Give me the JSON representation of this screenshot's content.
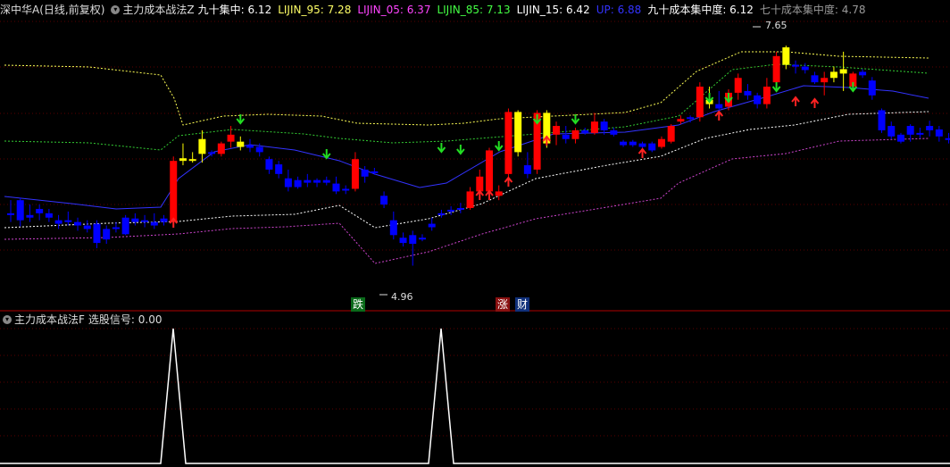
{
  "main_panel": {
    "stock_title": "深中华A(日线,前复权)",
    "indicator_name": "主力成本战法Z",
    "values": [
      {
        "label": "九十集中: 6.12",
        "color": "#ffffff"
      },
      {
        "label": "LIJIN_95: 7.28",
        "color": "#ffff66"
      },
      {
        "label": "LIJIN_05: 6.37",
        "color": "#ff44ff"
      },
      {
        "label": "LIJIN_85: 7.13",
        "color": "#44ff44"
      },
      {
        "label": "LIJIN_15: 6.42",
        "color": "#ffffff"
      },
      {
        "label": "UP: 6.88",
        "color": "#3333ff"
      },
      {
        "label": "九十成本集中度: 6.12",
        "color": "#ffffff"
      },
      {
        "label": "七十成本集中度: 4.78",
        "color": "#999999"
      }
    ],
    "high_label": "7.65",
    "low_label": "4.96",
    "signals": [
      {
        "text": "跌",
        "bg": "#0a6a1a",
        "color": "#ffffff"
      },
      {
        "text": "涨",
        "bg": "#8a1010",
        "color": "#ffffff"
      },
      {
        "text": "财",
        "bg": "#10307a",
        "color": "#ffffff"
      }
    ]
  },
  "sub_panel": {
    "indicator_name": "主力成本战法F",
    "value_label": "选股信号: 0.00"
  },
  "colors": {
    "background": "#000000",
    "up_candle": "#ff0000",
    "down_candle": "#0000ff",
    "yellow_candle": "#ffff00",
    "divider": "#b00000"
  },
  "candles": [
    [
      5.8,
      5.95,
      5.7,
      5.8,
      "b"
    ],
    [
      5.95,
      5.98,
      5.65,
      5.72,
      "b"
    ],
    [
      5.75,
      5.9,
      5.7,
      5.78,
      "b"
    ],
    [
      5.85,
      5.9,
      5.72,
      5.8,
      "b"
    ],
    [
      5.8,
      5.85,
      5.7,
      5.75,
      "b"
    ],
    [
      5.72,
      5.78,
      5.62,
      5.68,
      "b"
    ],
    [
      5.7,
      5.82,
      5.66,
      5.72,
      "b"
    ],
    [
      5.7,
      5.75,
      5.6,
      5.66,
      "b"
    ],
    [
      5.66,
      5.72,
      5.58,
      5.62,
      "b"
    ],
    [
      5.68,
      5.72,
      5.4,
      5.46,
      "b"
    ],
    [
      5.62,
      5.66,
      5.45,
      5.5,
      "b"
    ],
    [
      5.62,
      5.7,
      5.58,
      5.64,
      "b"
    ],
    [
      5.75,
      5.78,
      5.55,
      5.56,
      "b"
    ],
    [
      5.74,
      5.8,
      5.66,
      5.7,
      "b"
    ],
    [
      5.7,
      5.78,
      5.64,
      5.72,
      "b"
    ],
    [
      5.7,
      5.8,
      5.62,
      5.66,
      "b"
    ],
    [
      5.74,
      5.78,
      5.66,
      5.7,
      "b"
    ],
    [
      5.7,
      6.45,
      5.68,
      6.4,
      "r"
    ],
    [
      6.4,
      6.6,
      6.35,
      6.43,
      "y"
    ],
    [
      6.4,
      6.5,
      6.38,
      6.42,
      "y"
    ],
    [
      6.65,
      6.75,
      6.38,
      6.48,
      "y"
    ],
    [
      6.48,
      6.52,
      6.45,
      6.5,
      "b"
    ],
    [
      6.48,
      6.62,
      6.45,
      6.6,
      "r"
    ],
    [
      6.62,
      6.8,
      6.55,
      6.7,
      "r"
    ],
    [
      6.62,
      6.68,
      6.52,
      6.56,
      "y"
    ],
    [
      6.58,
      6.65,
      6.5,
      6.55,
      "b"
    ],
    [
      6.56,
      6.6,
      6.45,
      6.5,
      "b"
    ],
    [
      6.42,
      6.45,
      6.25,
      6.3,
      "b"
    ],
    [
      6.36,
      6.4,
      6.2,
      6.25,
      "b"
    ],
    [
      6.2,
      6.3,
      6.05,
      6.1,
      "b"
    ],
    [
      6.18,
      6.22,
      6.08,
      6.1,
      "b"
    ],
    [
      6.18,
      6.25,
      6.1,
      6.15,
      "b"
    ],
    [
      6.18,
      6.2,
      6.1,
      6.15,
      "b"
    ],
    [
      6.18,
      6.22,
      6.12,
      6.15,
      "b"
    ],
    [
      6.14,
      6.22,
      6.02,
      6.05,
      "b"
    ],
    [
      6.06,
      6.12,
      6.02,
      6.08,
      "b"
    ],
    [
      6.08,
      6.5,
      6.05,
      6.42,
      "r"
    ],
    [
      6.3,
      6.34,
      6.15,
      6.22,
      "b"
    ],
    [
      6.28,
      6.32,
      6.24,
      6.26,
      "b"
    ],
    [
      6.0,
      6.05,
      5.86,
      5.9,
      "b"
    ],
    [
      5.72,
      5.82,
      5.5,
      5.55,
      "b"
    ],
    [
      5.52,
      5.58,
      5.42,
      5.46,
      "b"
    ],
    [
      5.45,
      5.6,
      5.2,
      5.55,
      "b"
    ],
    [
      5.52,
      5.56,
      5.48,
      5.5,
      "b"
    ],
    [
      5.68,
      5.75,
      5.6,
      5.64,
      "b"
    ],
    [
      5.8,
      5.84,
      5.75,
      5.78,
      "b"
    ],
    [
      5.82,
      5.88,
      5.78,
      5.84,
      "b"
    ],
    [
      5.85,
      5.92,
      5.8,
      5.86,
      "b"
    ],
    [
      5.86,
      6.1,
      5.84,
      6.05,
      "r"
    ],
    [
      6.05,
      6.3,
      6.0,
      6.22,
      "r"
    ],
    [
      6.05,
      6.55,
      6.0,
      6.52,
      "r"
    ],
    [
      6.05,
      6.12,
      5.95,
      6.0,
      "r"
    ],
    [
      6.25,
      7.0,
      6.2,
      6.96,
      "r"
    ],
    [
      6.96,
      6.98,
      6.45,
      6.5,
      "y"
    ],
    [
      6.35,
      6.5,
      6.2,
      6.25,
      "b"
    ],
    [
      6.3,
      6.98,
      6.25,
      6.95,
      "r"
    ],
    [
      6.95,
      6.98,
      6.55,
      6.6,
      "y"
    ],
    [
      6.7,
      6.85,
      6.58,
      6.8,
      "r"
    ],
    [
      6.7,
      6.8,
      6.6,
      6.65,
      "b"
    ],
    [
      6.65,
      6.78,
      6.6,
      6.75,
      "r"
    ],
    [
      6.75,
      6.78,
      6.7,
      6.72,
      "b"
    ],
    [
      6.72,
      6.95,
      6.7,
      6.85,
      "r"
    ],
    [
      6.85,
      6.88,
      6.7,
      6.75,
      "b"
    ],
    [
      6.75,
      6.78,
      6.68,
      6.7,
      "b"
    ],
    [
      6.62,
      6.64,
      6.56,
      6.58,
      "b"
    ],
    [
      6.62,
      6.64,
      6.56,
      6.58,
      "b"
    ],
    [
      6.6,
      6.62,
      6.54,
      6.56,
      "b"
    ],
    [
      6.6,
      6.62,
      6.5,
      6.52,
      "b"
    ],
    [
      6.56,
      6.68,
      6.54,
      6.65,
      "r"
    ],
    [
      6.62,
      6.82,
      6.6,
      6.8,
      "r"
    ],
    [
      6.85,
      6.92,
      6.82,
      6.88,
      "r"
    ],
    [
      6.88,
      6.92,
      6.84,
      6.9,
      "b"
    ],
    [
      6.9,
      7.3,
      6.85,
      7.25,
      "r"
    ],
    [
      7.05,
      7.25,
      7.0,
      7.1,
      "y"
    ],
    [
      7.0,
      7.2,
      6.95,
      7.05,
      "b"
    ],
    [
      7.02,
      7.22,
      6.98,
      7.18,
      "r"
    ],
    [
      7.18,
      7.4,
      7.1,
      7.35,
      "r"
    ],
    [
      7.2,
      7.28,
      7.1,
      7.15,
      "b"
    ],
    [
      7.15,
      7.18,
      7.0,
      7.05,
      "b"
    ],
    [
      7.05,
      7.35,
      7.0,
      7.25,
      "r"
    ],
    [
      7.3,
      7.65,
      7.25,
      7.6,
      "r"
    ],
    [
      7.7,
      7.72,
      7.45,
      7.5,
      "y"
    ],
    [
      7.5,
      7.55,
      7.4,
      7.48,
      "b"
    ],
    [
      7.48,
      7.52,
      7.4,
      7.44,
      "b"
    ],
    [
      7.38,
      7.42,
      7.28,
      7.3,
      "b"
    ],
    [
      7.3,
      7.42,
      7.15,
      7.35,
      "r"
    ],
    [
      7.42,
      7.48,
      7.3,
      7.35,
      "y"
    ],
    [
      7.4,
      7.65,
      7.2,
      7.45,
      "y"
    ],
    [
      7.25,
      7.42,
      7.2,
      7.4,
      "r"
    ],
    [
      7.42,
      7.45,
      7.35,
      7.38,
      "b"
    ],
    [
      7.32,
      7.36,
      7.1,
      7.15,
      "b"
    ],
    [
      6.98,
      7.0,
      6.72,
      6.75,
      "b"
    ],
    [
      6.8,
      6.85,
      6.65,
      6.68,
      "b"
    ],
    [
      6.7,
      6.72,
      6.6,
      6.62,
      "b"
    ],
    [
      6.7,
      6.82,
      6.62,
      6.8,
      "b"
    ],
    [
      6.72,
      6.78,
      6.66,
      6.7,
      "b"
    ],
    [
      6.8,
      6.86,
      6.68,
      6.75,
      "b"
    ],
    [
      6.76,
      6.8,
      6.62,
      6.68,
      "b"
    ],
    [
      6.66,
      6.72,
      6.6,
      6.65,
      "b"
    ]
  ]
}
